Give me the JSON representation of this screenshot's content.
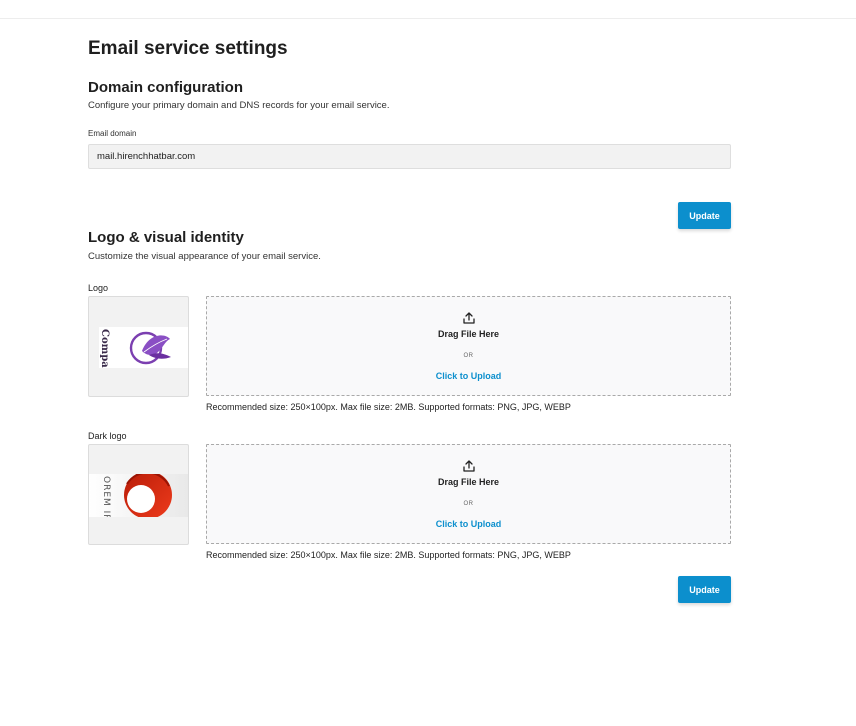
{
  "page": {
    "title": "Email service settings"
  },
  "domain": {
    "heading": "Domain configuration",
    "description": "Configure your primary domain and DNS records for your email service.",
    "field_label": "Email domain",
    "field_value": "mail.hirenchhatbar.com",
    "update_label": "Update"
  },
  "identity": {
    "heading": "Logo & visual identity",
    "description": "Customize the visual appearance of your email service.",
    "logo": {
      "label": "Logo",
      "preview_text": "Company",
      "drop_title": "Drag File Here",
      "drop_or": "OR",
      "drop_click": "Click to Upload",
      "hint": "Recommended size: 250×100px. Max file size: 2MB. Supported formats: PNG, JPG, WEBP"
    },
    "dark_logo": {
      "label": "Dark logo",
      "preview_text": "OREM IPSU",
      "drop_title": "Drag File Here",
      "drop_or": "OR",
      "drop_click": "Click to Upload",
      "hint": "Recommended size: 250×100px. Max file size: 2MB. Supported formats: PNG, JPG, WEBP"
    },
    "update_label": "Update"
  },
  "colors": {
    "accent": "#0c8fcd",
    "logo_purple": "#7b3fb0",
    "logo_red": "#d42a10"
  }
}
